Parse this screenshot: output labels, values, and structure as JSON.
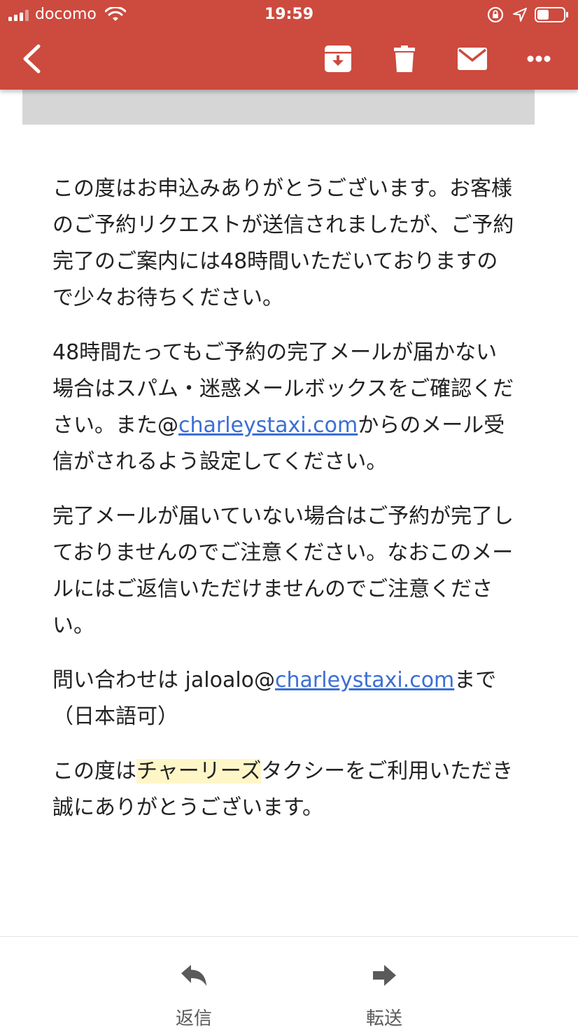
{
  "status_bar": {
    "carrier": "docomo",
    "time": "19:59"
  },
  "header": {
    "icons": [
      "back-arrow-icon",
      "archive-icon",
      "trash-icon",
      "mail-icon",
      "more-icon"
    ],
    "color": "#cd4a3e"
  },
  "email": {
    "paragraphs": {
      "p1": "この度はお申込みありがとうございます。お客様のご予約リクエストが送信されましたが、ご予約完了のご案内には48時間いただいておりますので少々お待ちください。",
      "p2_before": "48時間たってもご予約の完了メールが届かない場合はスパム・迷惑メールボックスをご確認ください。また@",
      "p2_link": "charleystaxi.com",
      "p2_after": "からのメール受信がされるよう設定してください。",
      "p3": "完了メールが届いていない場合はご予約が完了しておりませんのでご注意ください。なおこのメールにはご返信いただけませんのでご注意ください。",
      "p4_before": "問い合わせは jaloalo@",
      "p4_link": "charleystaxi.com",
      "p4_after": "まで（日本語可）",
      "p5_before": "この度は",
      "p5_highlight": "チャーリーズ",
      "p5_after": "タクシーをご利用いただき誠にありがとうございます。"
    },
    "link_color": "#3b6fd4"
  },
  "bottom_actions": {
    "reply_label": "返信",
    "forward_label": "転送"
  }
}
